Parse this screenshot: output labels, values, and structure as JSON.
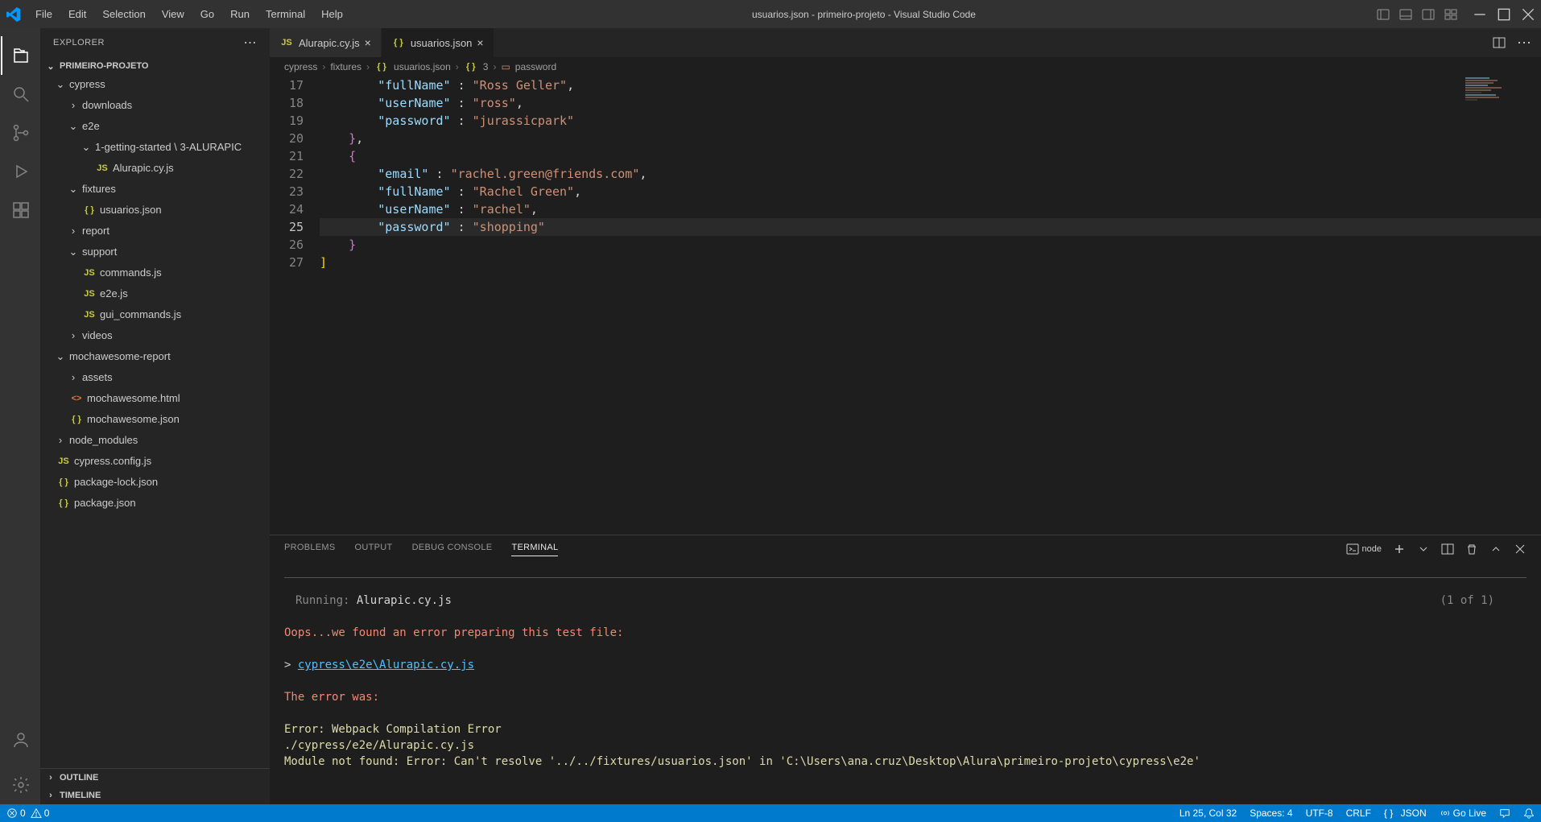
{
  "window_title": "usuarios.json - primeiro-projeto - Visual Studio Code",
  "menu": [
    "File",
    "Edit",
    "Selection",
    "View",
    "Go",
    "Run",
    "Terminal",
    "Help"
  ],
  "explorer": {
    "title": "EXPLORER",
    "project": "PRIMEIRO-PROJETO",
    "tree": {
      "cypress": "cypress",
      "downloads": "downloads",
      "e2e": "e2e",
      "gs": "1-getting-started \\ 3-ALURAPIC",
      "alurapic": "Alurapic.cy.js",
      "fixtures": "fixtures",
      "usuarios": "usuarios.json",
      "report": "report",
      "support": "support",
      "commands": "commands.js",
      "e2ejs": "e2e.js",
      "gui": "gui_commands.js",
      "videos": "videos",
      "mocha": "mochawesome-report",
      "assets": "assets",
      "mhtml": "mochawesome.html",
      "mjson": "mochawesome.json",
      "node": "node_modules",
      "cyconf": "cypress.config.js",
      "plock": "package-lock.json",
      "pkg": "package.json"
    },
    "outline": "OUTLINE",
    "timeline": "TIMELINE"
  },
  "tabs": [
    {
      "label": "Alurapic.cy.js",
      "icon": "JS"
    },
    {
      "label": "usuarios.json",
      "icon": "{}"
    }
  ],
  "breadcrumb": [
    "cypress",
    "fixtures",
    "usuarios.json",
    "3",
    "password"
  ],
  "code": {
    "line17": {
      "key": "\"fullName\"",
      "sep": " : ",
      "val": "\"Ross Geller\"",
      "end": ","
    },
    "line18": {
      "key": "\"userName\"",
      "sep": " : ",
      "val": "\"ross\"",
      "end": ","
    },
    "line19": {
      "key": "\"password\"",
      "sep": " : ",
      "val": "\"jurassicpark\""
    },
    "line22": {
      "key": "\"email\"",
      "sep": " : ",
      "val": "\"rachel.green@friends.com\"",
      "end": ","
    },
    "line23": {
      "key": "\"fullName\"",
      "sep": " : ",
      "val": "\"Rachel Green\"",
      "end": ","
    },
    "line24": {
      "key": "\"userName\"",
      "sep": " : ",
      "val": "\"rachel\"",
      "end": ","
    },
    "line25": {
      "key": "\"password\"",
      "sep": " : ",
      "val": "\"shopping\""
    }
  },
  "line_numbers": [
    "17",
    "18",
    "19",
    "20",
    "21",
    "22",
    "23",
    "24",
    "25",
    "26",
    "27"
  ],
  "panel": {
    "tabs": [
      "PROBLEMS",
      "OUTPUT",
      "DEBUG CONSOLE",
      "TERMINAL"
    ],
    "shell": "node"
  },
  "terminal": {
    "running_label": "Running:",
    "running_file": "Alurapic.cy.js",
    "progress": "(1 of 1)",
    "oops": "Oops...we found an error preparing this test file:",
    "path": "cypress\\e2e\\Alurapic.cy.js",
    "err_label": "The error was:",
    "err1": "Error: Webpack Compilation Error",
    "err2": "./cypress/e2e/Alurapic.cy.js",
    "err3": "Module not found: Error: Can't resolve '../../fixtures/usuarios.json' in 'C:\\Users\\ana.cruz\\Desktop\\Alura\\primeiro-projeto\\cypress\\e2e'"
  },
  "status": {
    "errors": "0",
    "warnings": "0",
    "ln": "Ln 25, Col 32",
    "spaces": "Spaces: 4",
    "encoding": "UTF-8",
    "eol": "CRLF",
    "lang": "JSON",
    "golive": "Go Live"
  }
}
